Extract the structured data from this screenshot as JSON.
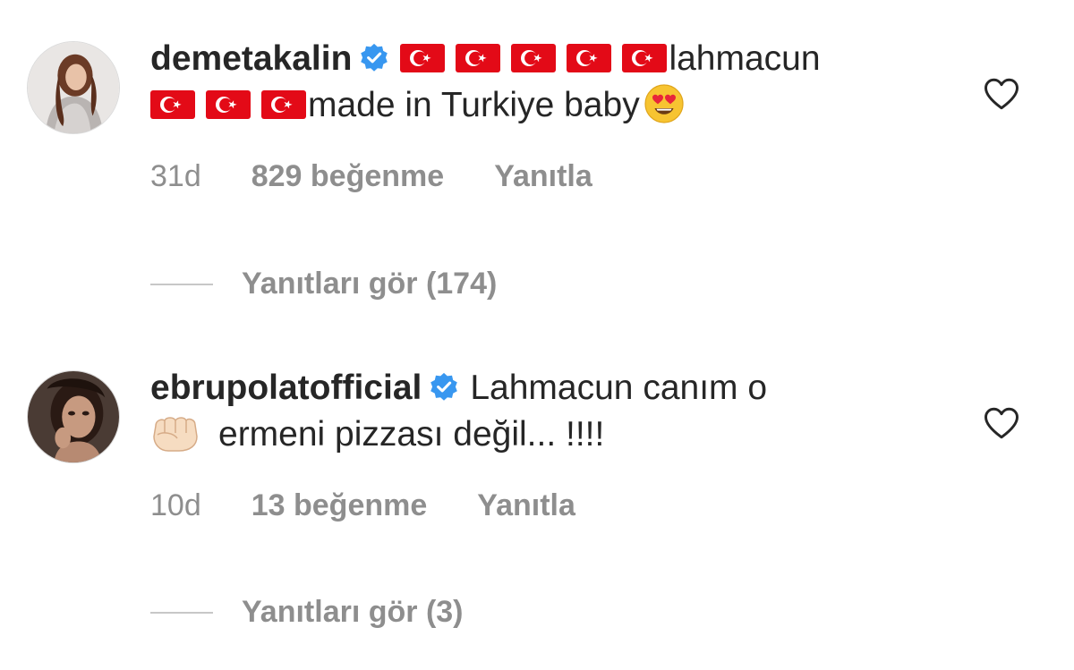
{
  "comments": [
    {
      "username": "demetakalin",
      "verified": true,
      "line1_text": "lahmacun",
      "line2_text": "made in Turkiye baby",
      "line1_flag_count": 5,
      "line2_flag_count": 3,
      "trailing_emoji": "heart-eyes-emoji",
      "time": "31d",
      "likes": "829 beğenme",
      "reply_label": "Yanıtla",
      "view_replies": "Yanıtları gör (174)",
      "liked": false
    },
    {
      "username": "ebrupolatofficial",
      "verified": true,
      "line1_text": "Lahmacun canım o",
      "line2_text": "ermeni pizzası değil... !!!!",
      "leading_emoji": "fist-emoji",
      "time": "10d",
      "likes": "13 beğenme",
      "reply_label": "Yanıtla",
      "view_replies": "Yanıtları gör (3)",
      "liked": false
    }
  ],
  "colors": {
    "text_primary": "#262626",
    "text_secondary": "#8e8e8e",
    "verified_blue": "#3897f0",
    "flag_red": "#e30a17",
    "divider": "#c7c7c7"
  },
  "icons": {
    "verified": "verified-badge-icon",
    "like": "heart-outline-icon",
    "flag": "turkey-flag-emoji"
  }
}
